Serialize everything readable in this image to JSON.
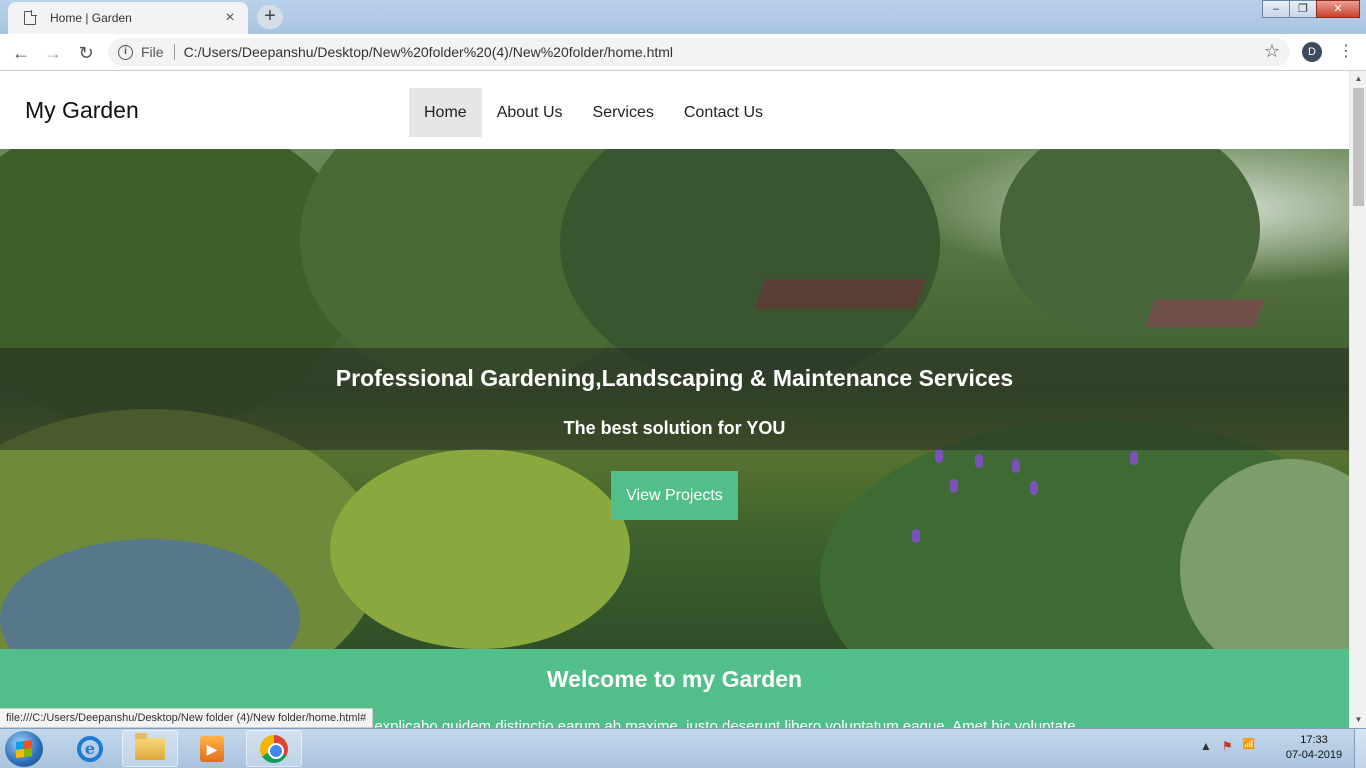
{
  "browser": {
    "tab_title": "Home | Garden",
    "tab_close": "×",
    "new_tab": "+",
    "back": "←",
    "forward": "→",
    "reload": "↻",
    "info_glyph": "i",
    "scheme_label": "File",
    "url": "C:/Users/Deepanshu/Desktop/New%20folder%20(4)/New%20folder/home.html",
    "bookmark": "☆",
    "profile_initial": "D",
    "menu": "⋮",
    "window_minimize": "–",
    "window_maximize": "❐",
    "window_close": "✕",
    "status_url": "file:///C:/Users/Deepanshu/Desktop/New folder (4)/New folder/home.html#"
  },
  "site": {
    "logo": "My Garden",
    "nav": [
      "Home",
      "About Us",
      "Services",
      "Contact Us"
    ],
    "active_nav": "Home",
    "hero": {
      "title": "Professional Gardening,Landscaping & Maintenance Services",
      "subtitle": "The best solution for YOU",
      "button": "View Projects"
    },
    "welcome": {
      "title": "Welcome to my Garden",
      "text": "...accusantium explicabo quidem distinctio earum ab maxime, iusto deserunt libero voluptatum eaque. Amet hic voluptate"
    }
  },
  "colors": {
    "accent": "#52be8a",
    "nav_active_bg": "#e6e6e6"
  },
  "scrollbar": {
    "up": "▲",
    "down": "▼"
  },
  "taskbar": {
    "apps": [
      "internet-explorer-icon",
      "file-explorer-icon",
      "media-player-icon",
      "chrome-icon"
    ],
    "tray_icons": [
      "show-hidden-icons-icon",
      "action-center-icon",
      "network-icon"
    ],
    "tray_glyphs": [
      "▲",
      "⚑",
      "📶"
    ],
    "time": "17:33",
    "date": "07-04-2019"
  }
}
